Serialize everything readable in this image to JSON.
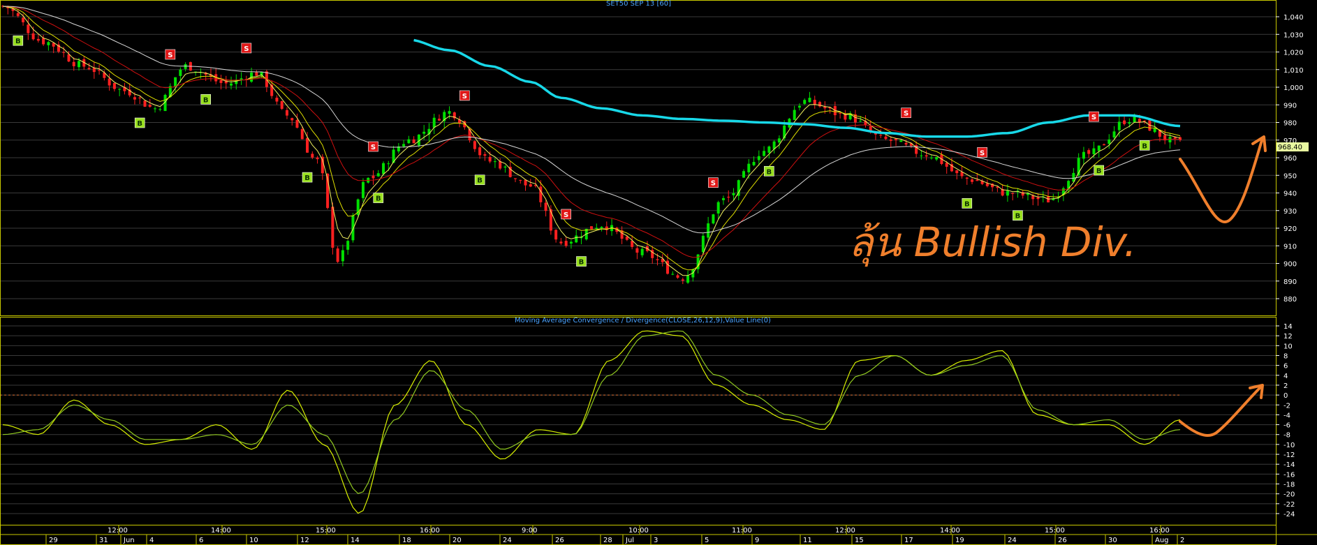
{
  "colors": {
    "background": "#000000",
    "frame": "#c8c800",
    "grid": "#3a3a3a",
    "axis_text": "#ffffff",
    "title_text": "#4aa3ff",
    "bull": "#00e000",
    "bear": "#ff2020",
    "ma_yellow": "#e0e000",
    "ma_red": "#d01010",
    "ma_white": "#d8d8d8",
    "ma_cyan": "#18d8e8",
    "macd_line": "#d8f000",
    "signal_line": "#90c820",
    "zero_line": "#e07030",
    "buy_marker": "#9ae020",
    "sell_marker": "#e01818",
    "annotation": "#f07f2c",
    "price_tag_bg": "#e8f8a0"
  },
  "price_panel": {
    "title": "SET50 SEP 13   [60]",
    "last_price_label": "968.40",
    "y_ticks": [
      "1,040",
      "1,030",
      "1,020",
      "1,010",
      "1,000",
      "990",
      "980",
      "970",
      "960",
      "950",
      "940",
      "930",
      "920",
      "910",
      "900",
      "890",
      "880"
    ],
    "annotation": "ลุ้น Bullish Div."
  },
  "macd_panel": {
    "title": "Moving Average Convergence / Divergence(CLOSE,26,12,9),Value Line(0)",
    "y_ticks": [
      "14",
      "12",
      "10",
      "8",
      "6",
      "4",
      "2",
      "0",
      "-2",
      "-4",
      "-6",
      "-8",
      "-10",
      "-12",
      "-14",
      "-16",
      "-18",
      "-20",
      "-22",
      "-24"
    ]
  },
  "time_axis": {
    "hours": [
      "12:00",
      "14:00",
      "15:00",
      "16:00",
      "9:00",
      "10:00",
      "11:00",
      "12:00",
      "14:00",
      "15:00",
      "16:00"
    ],
    "days": [
      "29",
      "31",
      "Jun",
      "4",
      "6",
      "10",
      "12",
      "14",
      "18",
      "20",
      "24",
      "26",
      "28",
      "Jul",
      "3",
      "5",
      "9",
      "11",
      "15",
      "17",
      "19",
      "24",
      "26",
      "30",
      "Aug",
      "2"
    ]
  },
  "signals": [
    {
      "type": "B",
      "label": "B"
    },
    {
      "type": "B",
      "label": "B"
    },
    {
      "type": "S",
      "label": "S"
    },
    {
      "type": "B",
      "label": "B"
    },
    {
      "type": "S",
      "label": "S"
    },
    {
      "type": "B",
      "label": "B"
    },
    {
      "type": "S",
      "label": "S"
    },
    {
      "type": "B",
      "label": "B"
    },
    {
      "type": "S",
      "label": "S"
    },
    {
      "type": "B",
      "label": "B"
    },
    {
      "type": "S",
      "label": "S"
    },
    {
      "type": "B",
      "label": "B"
    },
    {
      "type": "S",
      "label": "S"
    },
    {
      "type": "B",
      "label": "B"
    },
    {
      "type": "S",
      "label": "S"
    },
    {
      "type": "B",
      "label": "B"
    },
    {
      "type": "S",
      "label": "S"
    },
    {
      "type": "B",
      "label": "B"
    },
    {
      "type": "S",
      "label": "S"
    },
    {
      "type": "B",
      "label": "B"
    },
    {
      "type": "B",
      "label": "B"
    }
  ],
  "chart_data": [
    {
      "type": "line",
      "title": "SET50 SEP 13   [60]",
      "description_of_series": "hourly close approximation with moving averages",
      "ylim": [
        872,
        1046
      ],
      "grid": true,
      "x_index": [
        0,
        8,
        16,
        24,
        30,
        36,
        44,
        50,
        56,
        62,
        66,
        72,
        80,
        88,
        96,
        104,
        110,
        118,
        126,
        134,
        142,
        150,
        158,
        166,
        174,
        182,
        190,
        198,
        206,
        214,
        222,
        232
      ],
      "series": [
        {
          "name": "Price",
          "values": [
            1046,
            1026,
            1012,
            998,
            988,
            1012,
            1002,
            1008,
            984,
            958,
            902,
            948,
            970,
            986,
            958,
            944,
            912,
            922,
            906,
            892,
            936,
            964,
            992,
            984,
            970,
            962,
            948,
            940,
            936,
            962,
            982,
            968
          ]
        },
        {
          "name": "Cyan MA",
          "values": [
            null,
            null,
            null,
            null,
            null,
            null,
            null,
            null,
            null,
            null,
            null,
            null,
            1027,
            1021,
            1012,
            1003,
            994,
            988,
            984,
            982,
            981,
            980,
            979,
            977,
            974,
            972,
            972,
            974,
            980,
            984,
            984,
            978
          ]
        }
      ],
      "annotation": "ลุ้น Bullish Div.",
      "last_value_label": "968.40"
    },
    {
      "type": "line",
      "title": "Moving Average Convergence / Divergence(CLOSE,26,12,9),Value Line(0)",
      "ylim": [
        -25,
        15
      ],
      "grid": true,
      "series": [
        {
          "name": "",
          "values": [
            -6,
            -8,
            -1,
            -6,
            -10,
            -9,
            -6,
            -11,
            1,
            -10,
            -24,
            -2,
            7,
            -6,
            -13,
            -7,
            -8,
            7,
            13,
            12,
            2,
            -2,
            -5,
            -7,
            7,
            8,
            4,
            7,
            9,
            -4,
            -6,
            -6,
            -10,
            -5
          ]
        },
        {
          "name": "",
          "values": [
            -8,
            -7,
            -2,
            -5,
            -9,
            -9,
            -8,
            -10,
            -2,
            -8,
            -20,
            -5,
            5,
            -3,
            -11,
            -8,
            -8,
            4,
            12,
            13,
            4,
            0,
            -4,
            -6,
            4,
            8,
            4,
            6,
            8,
            -3,
            -6,
            -5,
            -9,
            -7
          ]
        }
      ],
      "reference_line": {
        "value": 0
      }
    }
  ]
}
